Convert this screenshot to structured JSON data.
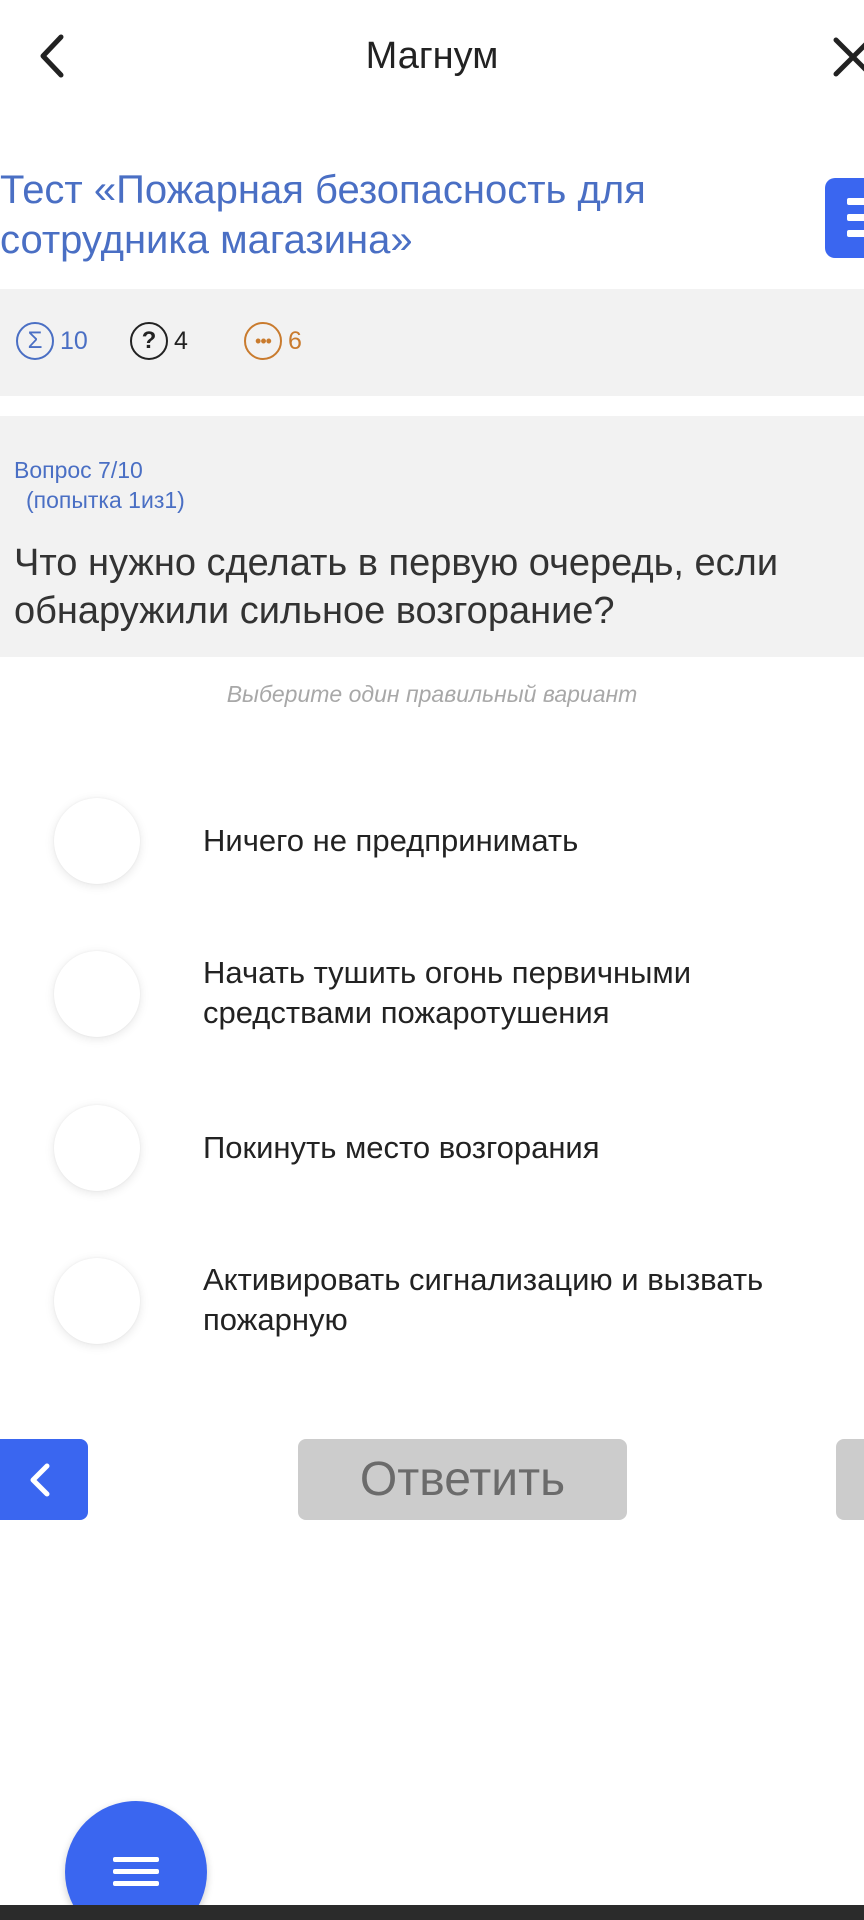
{
  "header": {
    "title": "Магнум",
    "back_icon": "chevron-left-icon",
    "close_icon": "close-icon"
  },
  "test": {
    "title_lines": [
      "Тест «Пожарная безопасность для",
      "сотрудника магазина»"
    ]
  },
  "stats": {
    "total": "10",
    "questions": "4",
    "remaining": "6",
    "total_icon": "sigma-icon",
    "questions_icon": "question-circle-icon",
    "remaining_icon": "more-circle-icon"
  },
  "question": {
    "number": "Вопрос 7/10",
    "attempt": "(попытка 1из1)",
    "text_lines": [
      "Что нужно сделать в первую очередь, если",
      "обнаружили сильное возгорание?"
    ],
    "hint": "Выберите один правильный вариант"
  },
  "options": [
    {
      "lines": [
        "Ничего не предпринимать"
      ]
    },
    {
      "lines": [
        "Начать тушить огонь первичными",
        "средствами пожаротушения"
      ]
    },
    {
      "lines": [
        "Покинуть место возгорания"
      ]
    },
    {
      "lines": [
        "Активировать сигнализацию и вызвать",
        "пожарную"
      ]
    }
  ],
  "nav": {
    "answer_label": "Ответить"
  },
  "colors": {
    "accent": "#3a66f0",
    "title_blue": "#4a6fc4",
    "orange": "#c97b2e",
    "disabled": "#cccccc"
  }
}
